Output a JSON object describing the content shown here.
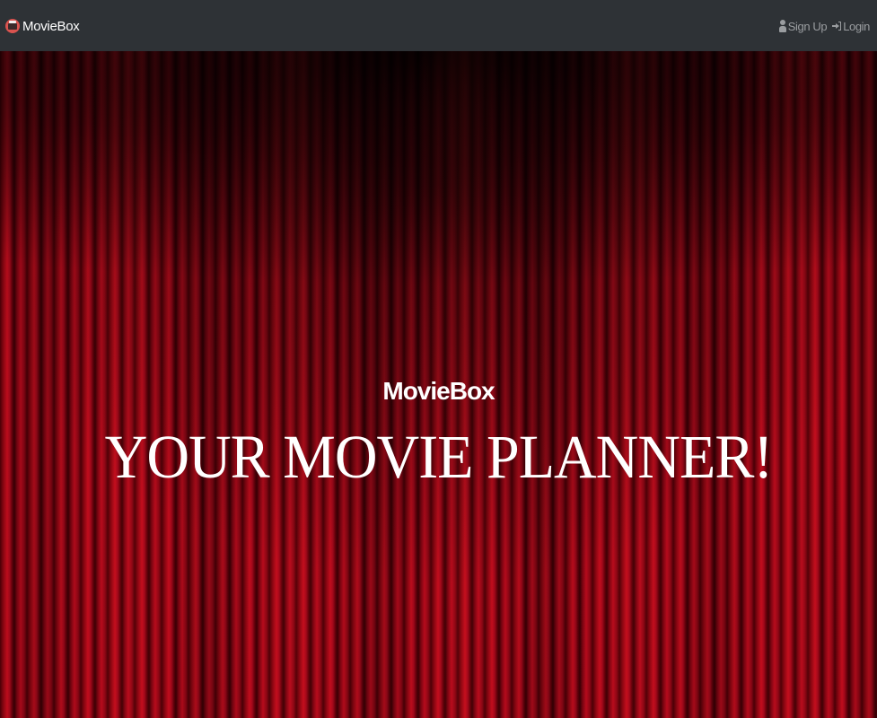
{
  "navbar": {
    "brand": {
      "logo_icon": "film-camera-icon",
      "label": "MovieBox"
    },
    "links": [
      {
        "icon": "user-icon",
        "label": "Sign Up"
      },
      {
        "icon": "login-icon",
        "label": "Login"
      }
    ]
  },
  "hero": {
    "background": "red-theater-curtain",
    "title": "MovieBox",
    "tagline": "YOUR MOVIE PLANNER!"
  },
  "colors": {
    "navbar_bg": "#2e3236",
    "nav_link": "#9a9da0",
    "curtain_red": "#b60b1c",
    "text": "#ffffff"
  }
}
